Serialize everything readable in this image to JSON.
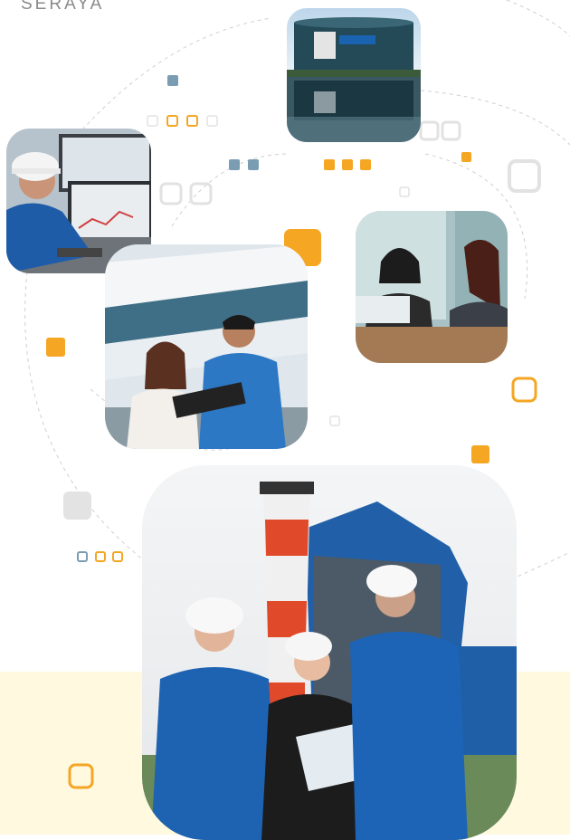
{
  "brand": {
    "text": "SERAYA"
  },
  "colors": {
    "accent_orange": "#f5a623",
    "accent_blue": "#7a9db3",
    "band_yellow": "#fff9e0",
    "grey_square": "#e3e3e3"
  },
  "photos": [
    {
      "name": "storage-tank-photo"
    },
    {
      "name": "control-room-operator-photo"
    },
    {
      "name": "colleagues-reviewing-folder-photo"
    },
    {
      "name": "office-meeting-photo"
    },
    {
      "name": "plant-engineers-photo"
    }
  ]
}
